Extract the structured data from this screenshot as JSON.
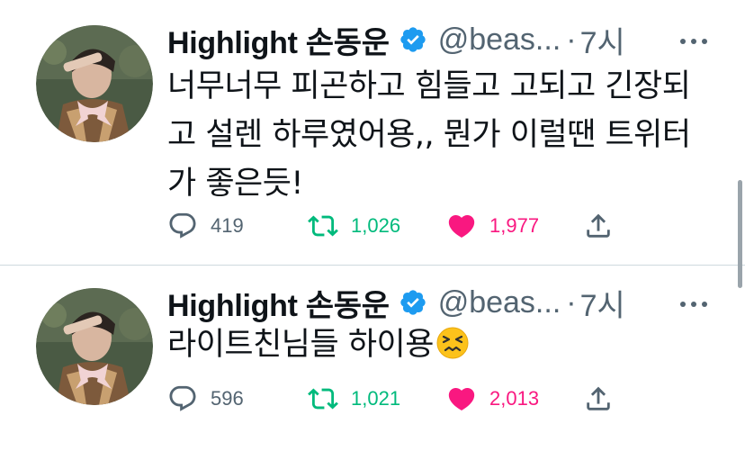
{
  "tweets": [
    {
      "display_name": "Highlight 손동운",
      "handle": "@beas...",
      "separator": "·",
      "time": "7시",
      "text": "너무너무 피곤하고 힘들고 고되고 긴장되고 설렌 하루였어용,, 뭔가 이럴땐 트위터가 좋은듯!",
      "replies": "419",
      "retweets": "1,026",
      "likes": "1,977",
      "liked": true,
      "retweeted": true
    },
    {
      "display_name": "Highlight 손동운",
      "handle": "@beas...",
      "separator": "·",
      "time": "7시",
      "text": "라이트친님들 하이용",
      "emoji": "confounded-face-emoji",
      "replies": "596",
      "retweets": "1,021",
      "likes": "2,013",
      "liked": true,
      "retweeted": true
    }
  ],
  "colors": {
    "text_primary": "#0f1419",
    "text_secondary": "#536471",
    "verified_blue": "#1d9bf0",
    "retweet_green": "#00ba7c",
    "like_pink": "#f91880",
    "divider": "#cfd9de"
  },
  "icons": {
    "reply": "reply-icon",
    "retweet": "retweet-icon",
    "like": "heart-icon",
    "share": "share-icon",
    "verified": "verified-badge-icon",
    "more": "more-options-icon"
  }
}
